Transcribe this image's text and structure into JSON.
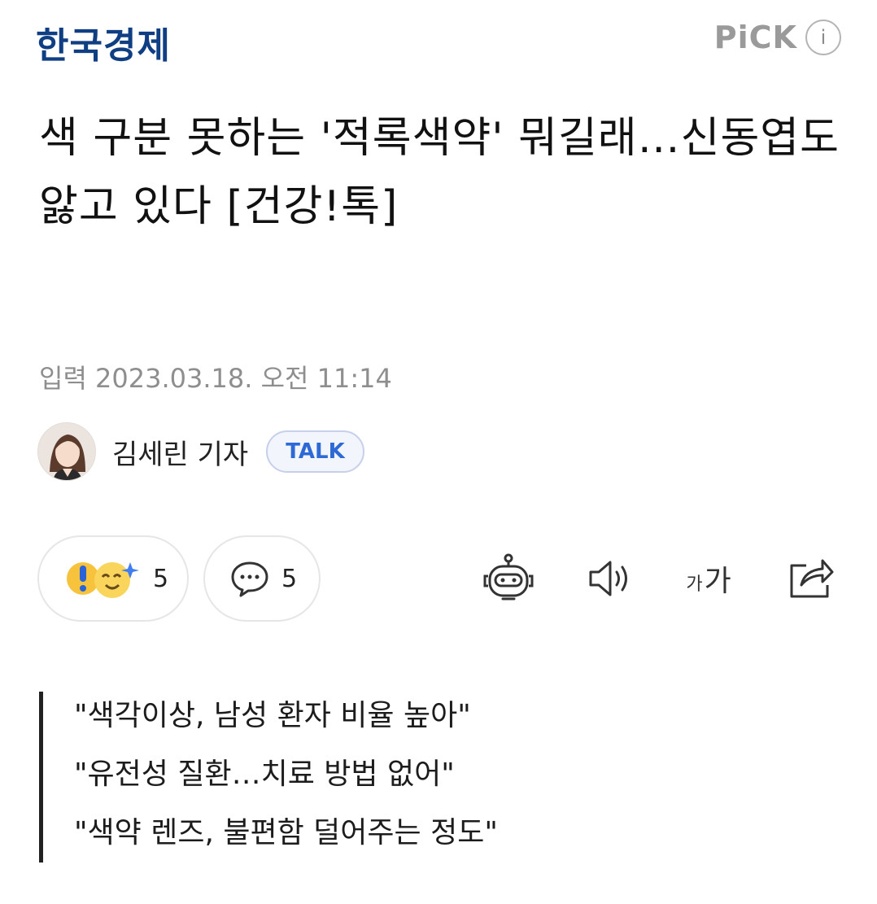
{
  "header": {
    "publisher": "한국경제",
    "badge": "PiCK",
    "info_icon": "i"
  },
  "article": {
    "title": "색 구분 못하는 '적록색약' 뭐길래…신동엽도 앓고 있다 [건강!톡]",
    "published": "입력 2023.03.18. 오전 11:14"
  },
  "author": {
    "name": "김세린 기자",
    "talk_label": "TALK"
  },
  "actions": {
    "reaction_count": "5",
    "comment_count": "5",
    "font_small": "가",
    "font_large": "가",
    "icons": [
      "reaction-icons",
      "comment-icon",
      "robot-summary-icon",
      "speaker-icon",
      "font-size-icon",
      "share-icon"
    ]
  },
  "summary": {
    "lines": [
      "\"색각이상, 남성 환자 비율 높아\"",
      "\"유전성 질환…치료 방법 없어\"",
      "\"색약 렌즈, 불편함 덜어주는 정도\""
    ]
  },
  "colors": {
    "brand": "#0f3e83",
    "talk_accent": "#2d6ad6",
    "muted": "#8e8e8e"
  }
}
